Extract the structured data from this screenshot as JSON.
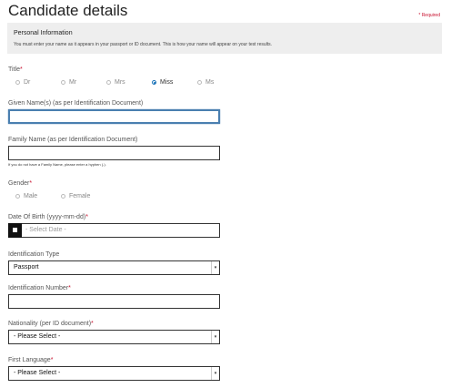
{
  "page": {
    "title": "Candidate details",
    "required_note": "* Required"
  },
  "panel": {
    "heading": "Personal Information",
    "text": "You must enter your name as it appears in your passport or ID document. This is how your name will appear on your test results."
  },
  "title_field": {
    "label": "Title",
    "required_mark": "*",
    "options": [
      "Dr",
      "Mr",
      "Mrs",
      "Miss",
      "Ms"
    ],
    "selected": "Miss"
  },
  "given_name": {
    "label": "Given Name(s) (as per Identification Document)",
    "value": ""
  },
  "family_name": {
    "label": "Family Name (as per Identification Document)",
    "value": "",
    "hint": "If you do not have a Family Name, please enter a hyphen (-)."
  },
  "gender": {
    "label": "Gender",
    "required_mark": "*",
    "options": [
      "Male",
      "Female"
    ]
  },
  "dob": {
    "label": "Date Of Birth (yyyy-mm-dd)",
    "required_mark": "*",
    "placeholder": "- Select Date -"
  },
  "id_type": {
    "label": "Identification Type",
    "selected": "Passport"
  },
  "id_number": {
    "label": "Identification Number",
    "required_mark": "*",
    "value": ""
  },
  "nationality": {
    "label": "Nationality (per ID document)",
    "required_mark": "*",
    "selected": "- Please Select -"
  },
  "first_language": {
    "label": "First Language",
    "required_mark": "*",
    "selected": "- Please Select -"
  },
  "colors": {
    "required": "#c8102e",
    "focus": "#4a7fb0",
    "panel": "#eeeeee"
  }
}
